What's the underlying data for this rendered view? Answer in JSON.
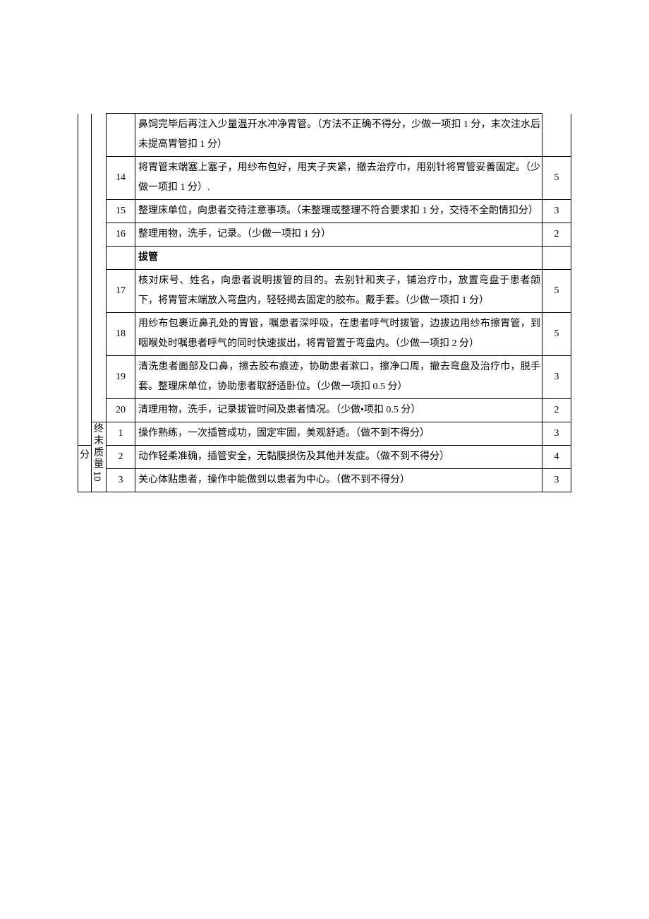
{
  "cat1": {
    "text": "分"
  },
  "cat2": {
    "line1": "终末质量",
    "line2": "10"
  },
  "rows": [
    {
      "num": "",
      "desc": "鼻饲完毕后再注入少量温开水冲净胃管。（方法不正确不得分，少做一项扣 1 分，末次注水后未提高胃管扣 1 分）",
      "score": ""
    },
    {
      "num": "14",
      "desc": "将胃管末端塞上塞子，用纱布包好，用夹子夹紧，撤去治疗巾，用别针将胃管妥善固定。（少做一项扣 1 分）.",
      "score": "5"
    },
    {
      "num": "15",
      "desc": "整理床单位，向患者交待注意事项。（未整理或整理不符合要求扣 1 分，交待不全酌情扣分）",
      "score": "3"
    },
    {
      "num": "16",
      "desc": "整理用物，洗手，记录。（少做一项扣 1 分）",
      "score": "2"
    },
    {
      "num": "",
      "desc": "拔管",
      "score": "",
      "header": true
    },
    {
      "num": "17",
      "desc": "核对床号、姓名，向患者说明拔管的目的。去别针和夹子，铺治疗巾，放置弯盘于患者颌下，将胃管末端放入弯盘内，轻轻揭去固定的胶布。戴手套。（少做一项扣 1 分）",
      "score": "5"
    },
    {
      "num": "18",
      "desc": "用纱布包裹近鼻孔处的胃管，嘱患者深呼吸，在患者呼气时拔管，边拔边用纱布擦胃管，到咽喉处时嘱患者呼气的同时快速拔出，将胃管置于弯盘内。（少做一项扣 2 分）",
      "score": "5"
    },
    {
      "num": "19",
      "desc": "清洗患者面部及口鼻，擦去胶布痕迹，协助患者漱口，擦净口周，撤去弯盘及治疗巾，脱手套。整理床单位，协助患者取舒适卧位。（少做一项扣 0.5 分）",
      "score": "3"
    },
    {
      "num": "20",
      "desc": "清理用物，洗手，记录拔管时间及患者情况。（少做•项扣 0.5 分）",
      "score": "2"
    }
  ],
  "rows2": [
    {
      "num": "1",
      "desc": "操作熟练，一次插管成功，固定牢固，美观舒适。（做不到不得分）",
      "score": "3"
    },
    {
      "num": "2",
      "desc": "动作轻柔准确，插管安全，无黏膜损伤及其他并发症。（做不到不得分）",
      "score": "4"
    },
    {
      "num": "3",
      "desc": "关心体贴患者，操作中能做到以患者为中心。（做不到不得分）",
      "score": "3"
    }
  ]
}
